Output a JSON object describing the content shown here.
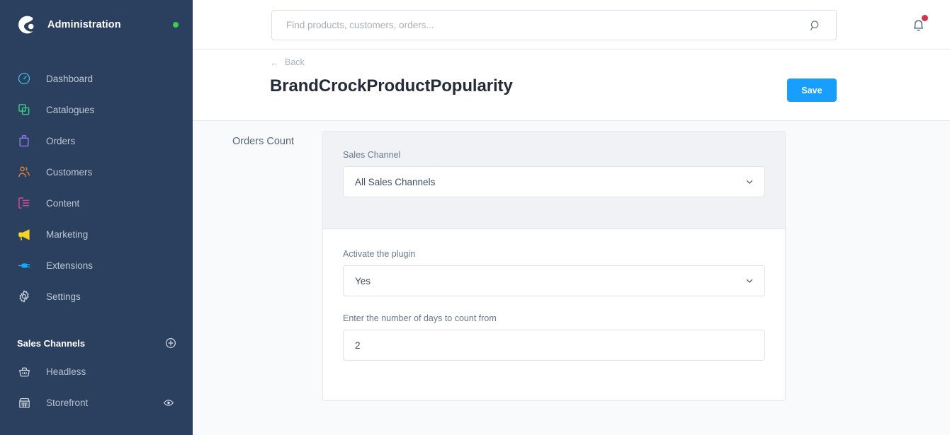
{
  "sidebar": {
    "brand": {
      "title": "Administration",
      "logo_icon": "shopware-logo-icon",
      "status_dot_color": "#37d046"
    },
    "background_color": "#2b405f",
    "items": [
      {
        "label": "Dashboard",
        "icon": "dashboard-gauge-icon",
        "color": "#46b3e6"
      },
      {
        "label": "Catalogues",
        "icon": "catalogues-copy-icon",
        "color": "#3ecf8e"
      },
      {
        "label": "Orders",
        "icon": "orders-bag-icon",
        "color": "#9b7cf0"
      },
      {
        "label": "Customers",
        "icon": "customers-people-icon",
        "color": "#f2862f"
      },
      {
        "label": "Content",
        "icon": "content-document-icon",
        "color": "#f0479c"
      },
      {
        "label": "Marketing",
        "icon": "marketing-megaphone-icon",
        "color": "#f5d324"
      },
      {
        "label": "Extensions",
        "icon": "extensions-plug-icon",
        "color": "#16a9f5"
      },
      {
        "label": "Settings",
        "icon": "settings-gear-icon",
        "color": "#c9d2dc"
      }
    ],
    "sales_channels": {
      "title": "Sales Channels",
      "add_icon": "plus-circle-icon",
      "channels": [
        {
          "label": "Headless",
          "icon": "headless-basket-icon",
          "action_icon": null
        },
        {
          "label": "Storefront",
          "icon": "storefront-shop-icon",
          "action_icon": "eye-icon"
        }
      ]
    }
  },
  "topbar": {
    "search": {
      "placeholder": "Find products, customers, orders...",
      "value": "",
      "icon": "search-icon"
    },
    "notifications": {
      "icon": "bell-icon",
      "has_badge": true,
      "badge_color": "#d1344a"
    }
  },
  "pagehead": {
    "back": {
      "label": "Back",
      "icon": "arrow-left-icon"
    },
    "title": "BrandCrockProductPopularity",
    "save_label": "Save",
    "save_color": "#189eff"
  },
  "content": {
    "section_label": "Orders Count",
    "fields": [
      {
        "label": "Sales Channel",
        "value": "All Sales Channels",
        "type": "select",
        "icon": "chevron-down-icon"
      },
      {
        "label": "Activate the plugin",
        "value": "Yes",
        "type": "select",
        "icon": "chevron-down-icon"
      },
      {
        "label": "Enter the number of days to count from",
        "value": "2",
        "type": "text",
        "icon": null
      }
    ]
  }
}
